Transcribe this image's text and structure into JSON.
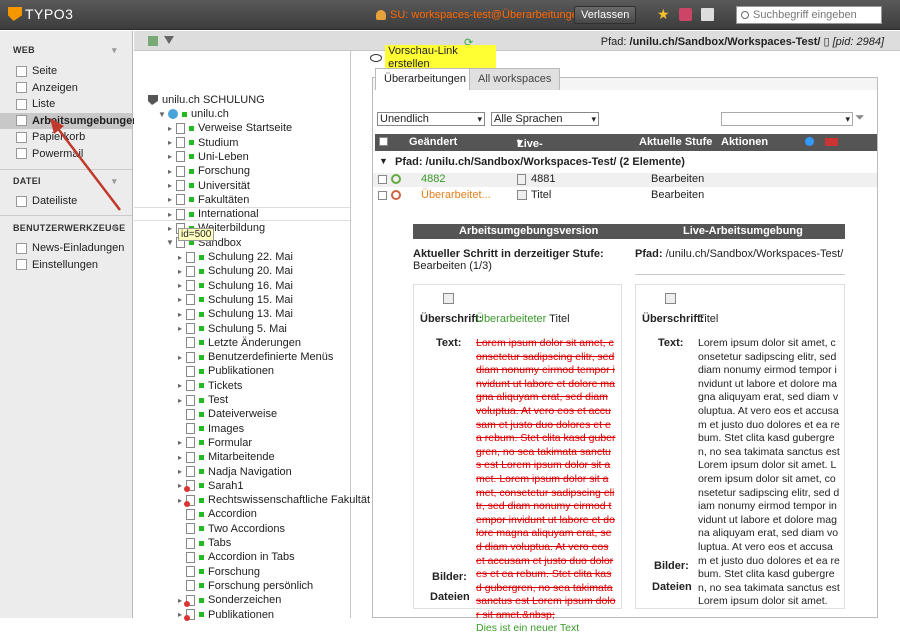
{
  "topbar": {
    "logo": "TYPO3",
    "su": "SU: workspaces-test@Überarbeitungen",
    "leave": "Verlassen",
    "search_placeholder": "Suchbegriff eingeben"
  },
  "modmenu": {
    "web_title": "WEB",
    "web": [
      {
        "label": "Seite",
        "icon": "page-icon"
      },
      {
        "label": "Anzeigen",
        "icon": "view-icon"
      },
      {
        "label": "Liste",
        "icon": "list-icon"
      },
      {
        "label": "Arbeitsumgebungen",
        "icon": "workspaces-icon"
      },
      {
        "label": "Papierkorb",
        "icon": "trash-icon"
      },
      {
        "label": "Powermail",
        "icon": "powermail-icon"
      }
    ],
    "file_title": "DATEI",
    "file": [
      {
        "label": "Dateiliste",
        "icon": "filelist-icon"
      }
    ],
    "tools_title": "BENUTZERWERKZEUGE",
    "tools": [
      {
        "label": "News-Einladungen",
        "icon": "news-icon"
      },
      {
        "label": "Einstellungen",
        "icon": "settings-icon"
      }
    ]
  },
  "navbar": {
    "path_label": "Pfad:",
    "path": "/unilu.ch/Sandbox/Workspaces-Test/",
    "pid": "[pid: 2984]"
  },
  "tree": {
    "root": "unilu.ch SCHULUNG",
    "tooltip": "id=500",
    "items": [
      {
        "label": "unilu.ch",
        "lvl": 0,
        "pm": "▼",
        "globe": true
      },
      {
        "label": "Verweise Startseite",
        "lvl": 1,
        "pm": "▸"
      },
      {
        "label": "Studium",
        "lvl": 1,
        "pm": "▸"
      },
      {
        "label": "Uni-Leben",
        "lvl": 1,
        "pm": "▸"
      },
      {
        "label": "Forschung",
        "lvl": 1,
        "pm": "▸"
      },
      {
        "label": "Universität",
        "lvl": 1,
        "pm": "▸"
      },
      {
        "label": "Fakultäten",
        "lvl": 1,
        "pm": "▸"
      },
      {
        "label": "International",
        "lvl": 1,
        "pm": "▸",
        "hl": true
      },
      {
        "label": "Weiterbildung",
        "lvl": 1,
        "pm": "▸"
      },
      {
        "label": "Sandbox",
        "lvl": 1,
        "pm": "▼"
      },
      {
        "label": "Schulung 22. Mai",
        "lvl": 2,
        "pm": "▸"
      },
      {
        "label": "Schulung 20. Mai",
        "lvl": 2,
        "pm": "▸"
      },
      {
        "label": "Schulung 16. Mai",
        "lvl": 2,
        "pm": "▸"
      },
      {
        "label": "Schulung 15. Mai",
        "lvl": 2,
        "pm": "▸"
      },
      {
        "label": "Schulung 13. Mai",
        "lvl": 2,
        "pm": "▸"
      },
      {
        "label": "Schulung 5. Mai",
        "lvl": 2,
        "pm": "▸"
      },
      {
        "label": "Letzte Änderungen",
        "lvl": 2,
        "pm": ""
      },
      {
        "label": "Benutzerdefinierte Menüs",
        "lvl": 2,
        "pm": "▸"
      },
      {
        "label": "Publikationen",
        "lvl": 2,
        "pm": ""
      },
      {
        "label": "Tickets",
        "lvl": 2,
        "pm": "▸"
      },
      {
        "label": "Test",
        "lvl": 2,
        "pm": "▸"
      },
      {
        "label": "Dateiverweise",
        "lvl": 2,
        "pm": ""
      },
      {
        "label": "Images",
        "lvl": 2,
        "pm": ""
      },
      {
        "label": "Formular",
        "lvl": 2,
        "pm": "▸"
      },
      {
        "label": "Mitarbeitende",
        "lvl": 2,
        "pm": "▸"
      },
      {
        "label": "Nadja Navigation",
        "lvl": 2,
        "pm": "▸"
      },
      {
        "label": "Sarah1",
        "lvl": 2,
        "pm": "▸",
        "red": true
      },
      {
        "label": "Rechtswissenschaftliche Fakultät",
        "lvl": 2,
        "pm": "▸",
        "red": true
      },
      {
        "label": "Accordion",
        "lvl": 2,
        "pm": ""
      },
      {
        "label": "Two Accordions",
        "lvl": 2,
        "pm": ""
      },
      {
        "label": "Tabs",
        "lvl": 2,
        "pm": ""
      },
      {
        "label": "Accordion in Tabs",
        "lvl": 2,
        "pm": ""
      },
      {
        "label": "Forschung",
        "lvl": 2,
        "pm": ""
      },
      {
        "label": "Forschung persönlich",
        "lvl": 2,
        "pm": ""
      },
      {
        "label": "Sonderzeichen",
        "lvl": 2,
        "pm": "▸",
        "red": true
      },
      {
        "label": "Publikationen",
        "lvl": 2,
        "pm": "▸",
        "red": true
      }
    ]
  },
  "preview": {
    "label": "Vorschau-Link erstellen"
  },
  "tabs": [
    "Überarbeitungen",
    "All workspaces"
  ],
  "filters": {
    "depth": "Unendlich",
    "lang": "Alle Sprachen"
  },
  "table": {
    "headers": [
      "Geändert",
      "Live-Titel",
      "Aktuelle Stufe",
      "Aktionen"
    ],
    "group": "Pfad: /unilu.ch/Sandbox/Workspaces-Test/ (2 Elemente)",
    "rows": [
      {
        "changed": "4882",
        "live": "4881",
        "stage": "Bearbeiten"
      },
      {
        "changed": "Überarbeitet...",
        "live": "Titel",
        "stage": "Bearbeiten"
      }
    ]
  },
  "compare": {
    "col_left": "Arbeitsumgebungsversion",
    "col_right": "Live-Arbeitsumgebung",
    "stage_label": "Aktueller Schritt in derzeitiger Stufe:",
    "stage_value": "Bearbeiten (1/3)",
    "path_label": "Pfad:",
    "path": "/unilu.ch/Sandbox/Workspaces-Test/",
    "heading_label": "Überschrift:",
    "heading_new": "Überarbeiteter",
    "heading_rest": " Titel",
    "heading_live": "Titel",
    "text_label": "Text:",
    "text_old": "Lorem ipsum dolor sit amet, consetetur sadipscing elitr, sed diam nonumy eirmod tempor invidunt ut labore et dolore magna aliquyam erat, sed diam voluptua. At vero eos et accusam et justo duo dolores et ea rebum. Stet clita kasd gubergren, no sea takimata sanctus est Lorem ipsum dolor sit amet. Lorem ipsum dolor sit amet, consetetur sadipscing elitr, sed diam nonumy eirmod tempor invidunt ut labore et dolore magna aliquyam erat, sed diam voluptua. At vero eos et accusam et justo duo dolores et ea rebum. Stet clita kasd gubergren, no sea takimata sanctus est Lorem ipsum dolor sit amet.&nbsp;",
    "text_new": "Dies ist ein neuer Text",
    "text_live": "Lorem ipsum dolor sit amet, consetetur sadipscing elitr, sed diam nonumy eirmod tempor invidunt ut labore et dolore magna aliquyam erat, sed diam voluptua. At vero eos et accusam et justo duo dolores et ea rebum. Stet clita kasd gubergren, no sea takimata sanctus est Lorem ipsum dolor sit amet. Lorem ipsum dolor sit amet, consetetur sadipscing elitr, sed diam nonumy eirmod tempor invidunt ut labore et dolore magna aliquyam erat, sed diam voluptua. At vero eos et accusam et justo duo dolores et ea rebum. Stet clita kasd gubergren, no sea takimata sanctus est Lorem ipsum dolor sit amet.",
    "images_label": "Bilder:",
    "files_label": "Dateien"
  },
  "colors": {
    "accent_green": "#3a9a2a",
    "changed_orange": "#e08020",
    "strike_red": "#dd0000",
    "header_dark": "#555555"
  }
}
